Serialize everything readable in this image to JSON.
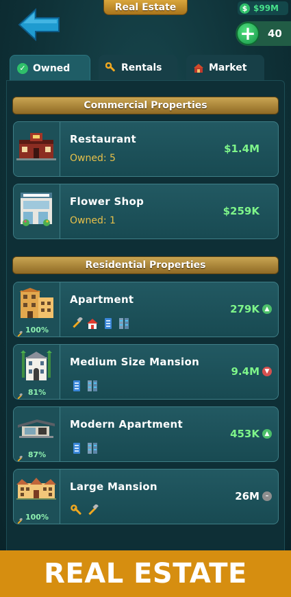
{
  "header": {
    "title": "Real Estate",
    "money": "$99M",
    "money_icon": "$",
    "gems": "40",
    "plus_label": "+"
  },
  "tabs": [
    {
      "label": "Owned",
      "icon": "check-circle-icon",
      "active": true
    },
    {
      "label": "Rentals",
      "icon": "wrench-icon",
      "active": false
    },
    {
      "label": "Market",
      "icon": "house-market-icon",
      "active": false
    }
  ],
  "commercial": {
    "heading": "Commercial Properties",
    "items": [
      {
        "name": "Restaurant",
        "owned": "Owned: 5",
        "price": "$1.4M",
        "icon": "restaurant-icon"
      },
      {
        "name": "Flower Shop",
        "owned": "Owned: 1",
        "price": "$259K",
        "icon": "flower-shop-icon"
      }
    ]
  },
  "residential": {
    "heading": "Residential Properties",
    "items": [
      {
        "name": "Apartment",
        "condition": "100%",
        "price": "279K",
        "trend": "up",
        "trend_glyph": "▲",
        "amenities": [
          "hammer-icon",
          "house-icon",
          "server-icon",
          "cabinet-icon"
        ]
      },
      {
        "name": "Medium Size Mansion",
        "condition": "81%",
        "price": "9.4M",
        "trend": "down",
        "trend_glyph": "▼",
        "amenities": [
          "server-icon",
          "cabinet-icon"
        ]
      },
      {
        "name": "Modern Apartment",
        "condition": "87%",
        "price": "453K",
        "trend": "up",
        "trend_glyph": "▲",
        "amenities": [
          "server-icon",
          "cabinet-icon"
        ]
      },
      {
        "name": "Large Mansion",
        "condition": "100%",
        "price": "26M",
        "trend": "flat",
        "trend_glyph": "–",
        "amenities": [
          "wrench-icon",
          "hammer-icon"
        ]
      }
    ]
  },
  "banner": {
    "text": "REAL ESTATE"
  },
  "colors": {
    "gold": "#c9a552",
    "price_green": "#7ef58a",
    "owned_yellow": "#e7c04a",
    "banner_orange": "#d68e10",
    "card_teal": "#225962"
  }
}
